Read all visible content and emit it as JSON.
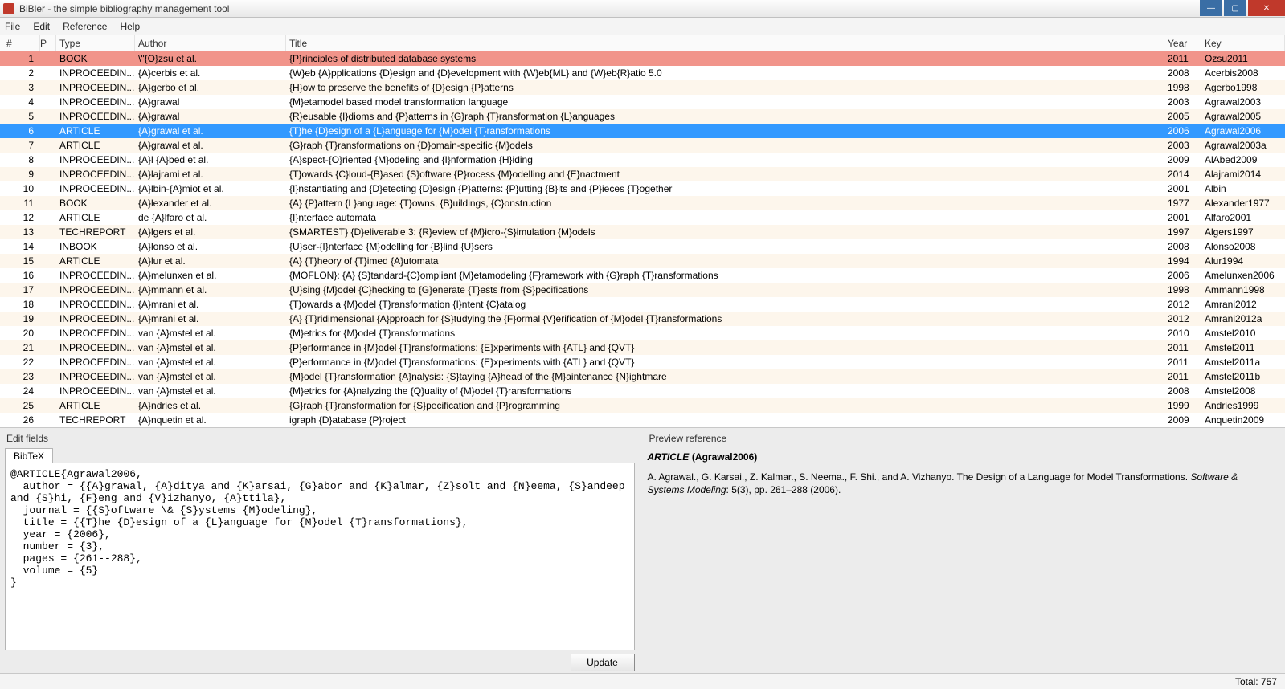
{
  "window": {
    "title": "BiBler - the simple bibliography management tool"
  },
  "menu": [
    "File",
    "Edit",
    "Reference",
    "Help"
  ],
  "columns": {
    "num": "#",
    "p": "P",
    "type": "Type",
    "author": "Author",
    "title": "Title",
    "year": "Year",
    "key": "Key"
  },
  "rows": [
    {
      "n": "1",
      "type": "BOOK",
      "author": "\\\"{O}zsu et al.",
      "title": "{P}rinciples of distributed database systems",
      "year": "2011",
      "key": "Ozsu2011",
      "cls": "red"
    },
    {
      "n": "2",
      "type": "INPROCEEDIN...",
      "author": "{A}cerbis et al.",
      "title": "{W}eb {A}pplications {D}esign and {D}evelopment with {W}eb{ML} and {W}eb{R}atio 5.0",
      "year": "2008",
      "key": "Acerbis2008"
    },
    {
      "n": "3",
      "type": "INPROCEEDIN...",
      "author": "{A}gerbo et al.",
      "title": "{H}ow to preserve the benefits of {D}esign {P}atterns",
      "year": "1998",
      "key": "Agerbo1998"
    },
    {
      "n": "4",
      "type": "INPROCEEDIN...",
      "author": "{A}grawal",
      "title": "{M}etamodel based model transformation language",
      "year": "2003",
      "key": "Agrawal2003"
    },
    {
      "n": "5",
      "type": "INPROCEEDIN...",
      "author": "{A}grawal",
      "title": "{R}eusable {I}dioms and {P}atterns in {G}raph {T}ransformation {L}anguages",
      "year": "2005",
      "key": "Agrawal2005"
    },
    {
      "n": "6",
      "type": "ARTICLE",
      "author": "{A}grawal et al.",
      "title": "{T}he {D}esign of a {L}anguage for {M}odel {T}ransformations",
      "year": "2006",
      "key": "Agrawal2006",
      "cls": "sel"
    },
    {
      "n": "7",
      "type": "ARTICLE",
      "author": "{A}grawal et al.",
      "title": "{G}raph {T}ransformations on {D}omain-specific {M}odels",
      "year": "2003",
      "key": "Agrawal2003a"
    },
    {
      "n": "8",
      "type": "INPROCEEDIN...",
      "author": "{A}l {A}bed et al.",
      "title": "{A}spect-{O}riented {M}odeling and {I}nformation {H}iding",
      "year": "2009",
      "key": "AlAbed2009"
    },
    {
      "n": "9",
      "type": "INPROCEEDIN...",
      "author": "{A}lajrami et al.",
      "title": "{T}owards {C}loud-{B}ased {S}oftware {P}rocess {M}odelling and {E}nactment",
      "year": "2014",
      "key": "Alajrami2014"
    },
    {
      "n": "10",
      "type": "INPROCEEDIN...",
      "author": "{A}lbin-{A}miot et al.",
      "title": "{I}nstantiating and {D}etecting {D}esign {P}atterns: {P}utting {B}its and {P}ieces {T}ogether",
      "year": "2001",
      "key": "Albin"
    },
    {
      "n": "11",
      "type": "BOOK",
      "author": "{A}lexander et al.",
      "title": "{A} {P}attern {L}anguage: {T}owns, {B}uildings, {C}onstruction",
      "year": "1977",
      "key": "Alexander1977"
    },
    {
      "n": "12",
      "type": "ARTICLE",
      "author": "de {A}lfaro et al.",
      "title": "{I}nterface automata",
      "year": "2001",
      "key": "Alfaro2001"
    },
    {
      "n": "13",
      "type": "TECHREPORT",
      "author": "{A}lgers et al.",
      "title": "{SMARTEST} {D}eliverable 3: {R}eview of {M}icro-{S}imulation {M}odels",
      "year": "1997",
      "key": "Algers1997"
    },
    {
      "n": "14",
      "type": "INBOOK",
      "author": "{A}lonso et al.",
      "title": "{U}ser-{I}nterface {M}odelling for {B}lind {U}sers",
      "year": "2008",
      "key": "Alonso2008"
    },
    {
      "n": "15",
      "type": "ARTICLE",
      "author": "{A}lur et al.",
      "title": "{A} {T}heory of {T}imed {A}utomata",
      "year": "1994",
      "key": "Alur1994"
    },
    {
      "n": "16",
      "type": "INPROCEEDIN...",
      "author": "{A}melunxen et al.",
      "title": "{MOFLON}: {A} {S}tandard-{C}ompliant {M}etamodeling {F}ramework with {G}raph {T}ransformations",
      "year": "2006",
      "key": "Amelunxen2006"
    },
    {
      "n": "17",
      "type": "INPROCEEDIN...",
      "author": "{A}mmann et al.",
      "title": "{U}sing {M}odel {C}hecking to {G}enerate {T}ests from {S}pecifications",
      "year": "1998",
      "key": "Ammann1998"
    },
    {
      "n": "18",
      "type": "INPROCEEDIN...",
      "author": "{A}mrani et al.",
      "title": "{T}owards a {M}odel {T}ransformation {I}ntent {C}atalog",
      "year": "2012",
      "key": "Amrani2012"
    },
    {
      "n": "19",
      "type": "INPROCEEDIN...",
      "author": "{A}mrani et al.",
      "title": "{A} {T}ridimensional {A}pproach for {S}tudying the {F}ormal {V}erification of {M}odel {T}ransformations",
      "year": "2012",
      "key": "Amrani2012a"
    },
    {
      "n": "20",
      "type": "INPROCEEDIN...",
      "author": "van {A}mstel et al.",
      "title": "{M}etrics for {M}odel {T}ransformations",
      "year": "2010",
      "key": "Amstel2010"
    },
    {
      "n": "21",
      "type": "INPROCEEDIN...",
      "author": "van {A}mstel et al.",
      "title": "{P}erformance in {M}odel {T}ransformations: {E}xperiments with {ATL} and {QVT}",
      "year": "2011",
      "key": "Amstel2011"
    },
    {
      "n": "22",
      "type": "INPROCEEDIN...",
      "author": "van {A}mstel et al.",
      "title": "{P}erformance in {M}odel {T}ransformations: {E}xperiments with {ATL} and {QVT}",
      "year": "2011",
      "key": "Amstel2011a"
    },
    {
      "n": "23",
      "type": "INPROCEEDIN...",
      "author": "van {A}mstel et al.",
      "title": "{M}odel {T}ransformation {A}nalysis: {S}taying {A}head of the {M}aintenance {N}ightmare",
      "year": "2011",
      "key": "Amstel2011b"
    },
    {
      "n": "24",
      "type": "INPROCEEDIN...",
      "author": "van {A}mstel et al.",
      "title": "{M}etrics for {A}nalyzing the {Q}uality of {M}odel {T}ransformations",
      "year": "2008",
      "key": "Amstel2008"
    },
    {
      "n": "25",
      "type": "ARTICLE",
      "author": "{A}ndries et al.",
      "title": "{G}raph {T}ransformation for {S}pecification and {P}rogramming",
      "year": "1999",
      "key": "Andries1999"
    },
    {
      "n": "26",
      "type": "TECHREPORT",
      "author": "{A}nquetin et al.",
      "title": "igraph {D}atabase {P}roject",
      "year": "2009",
      "key": "Anquetin2009"
    }
  ],
  "edit": {
    "label": "Edit fields",
    "tab": "BibTeX",
    "text": "@ARTICLE{Agrawal2006,\n  author = {{A}grawal, {A}ditya and {K}arsai, {G}abor and {K}almar, {Z}solt and {N}eema, {S}andeep and {S}hi, {F}eng and {V}izhanyo, {A}ttila},\n  journal = {{S}oftware \\& {S}ystems {M}odeling},\n  title = {{T}he {D}esign of a {L}anguage for {M}odel {T}ransformations},\n  year = {2006},\n  number = {3},\n  pages = {261--288},\n  volume = {5}\n}",
    "update": "Update"
  },
  "preview": {
    "label": "Preview reference",
    "heading_type": "ARTICLE",
    "heading_key": "(Agrawal2006)",
    "body_plain1": "A. Agrawal., G. Karsai., Z. Kalmar., S. Neema., F. Shi., and A. Vizhanyo. The Design of a Language for Model Transformations. ",
    "body_italic": "Software & Systems Modeling",
    "body_plain2": ": 5(3), pp. 261–288 (2006)."
  },
  "status": {
    "total": "Total: 757"
  }
}
